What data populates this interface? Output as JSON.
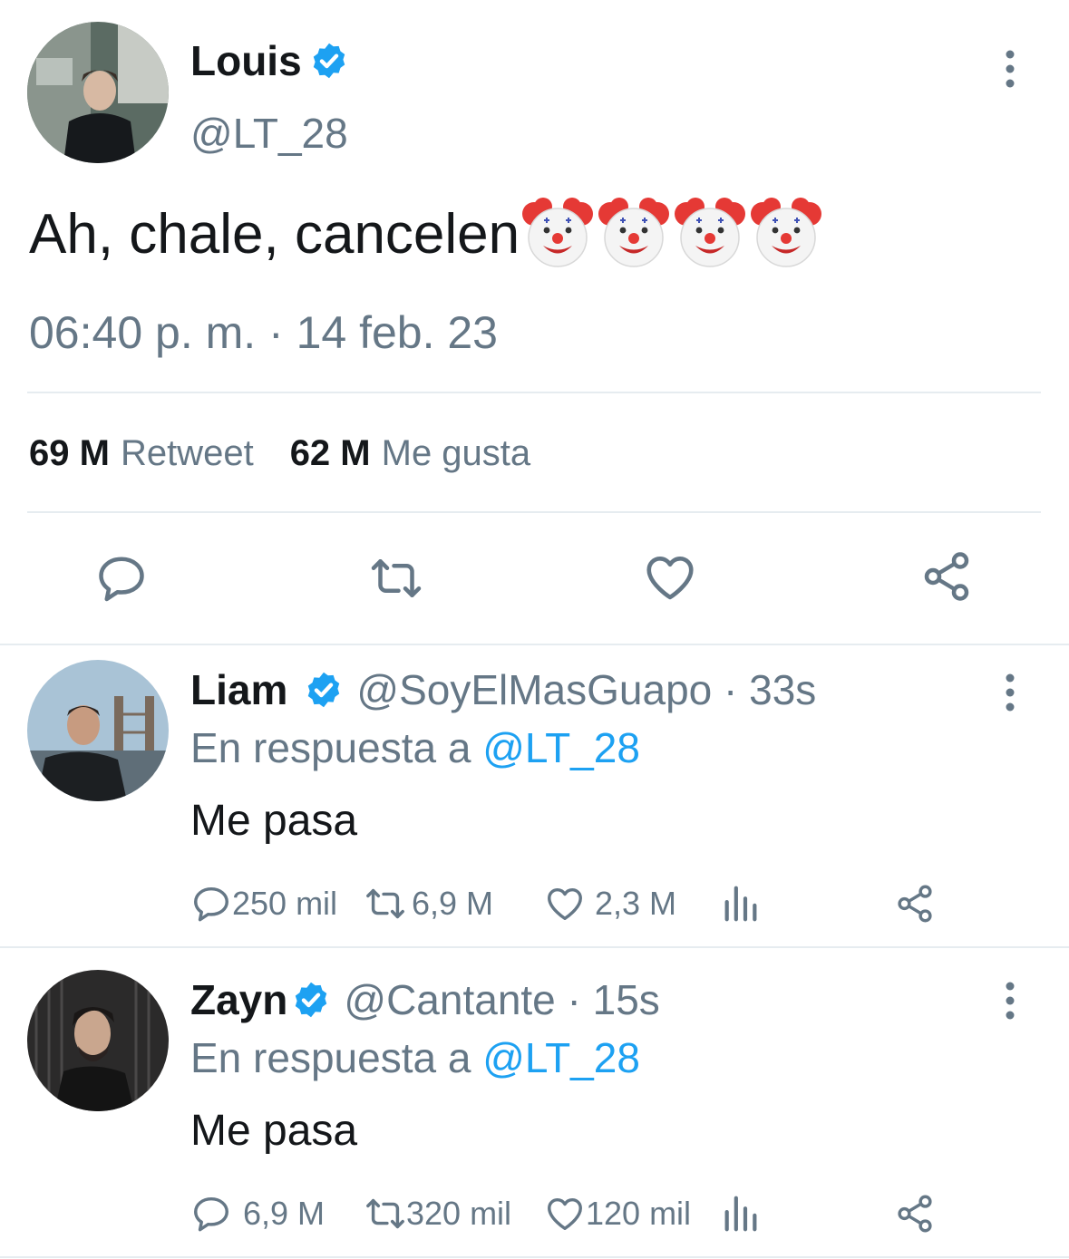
{
  "main_tweet": {
    "author_name": "Louis",
    "author_handle": "@LT_28",
    "text": "Ah, chale, cancelen",
    "emojis": [
      "clown-face",
      "clown-face",
      "clown-face",
      "clown-face"
    ],
    "timestamp": "06:40 p. m. · 14 feb. 23",
    "retweet_count": "69 M",
    "retweet_label": "Retweet",
    "like_count": "62 M",
    "like_label": "Me gusta"
  },
  "replies": [
    {
      "author_name": "Liam",
      "author_handle": "@SoyElMasGuapo · 33s",
      "reply_prefix": "En respuesta a ",
      "reply_mention": "@LT_28",
      "text": "Me pasa",
      "reply_count": "250 mil",
      "retweet_count": "6,9 M",
      "like_count": "2,3 M"
    },
    {
      "author_name": "Zayn",
      "author_handle": "@Cantante · 15s",
      "reply_prefix": "En respuesta a ",
      "reply_mention": "@LT_28",
      "text": "Me pasa",
      "reply_count": "6,9 M",
      "retweet_count": "320 mil",
      "like_count": "120 mil"
    }
  ],
  "colors": {
    "accent": "#1da1f2",
    "text_primary": "#14171a",
    "text_secondary": "#657786",
    "divider": "#e6ecf0"
  },
  "icons": [
    "verified-badge-icon",
    "more-options-icon",
    "reply-icon",
    "retweet-icon",
    "like-icon",
    "share-icon",
    "analytics-icon"
  ]
}
